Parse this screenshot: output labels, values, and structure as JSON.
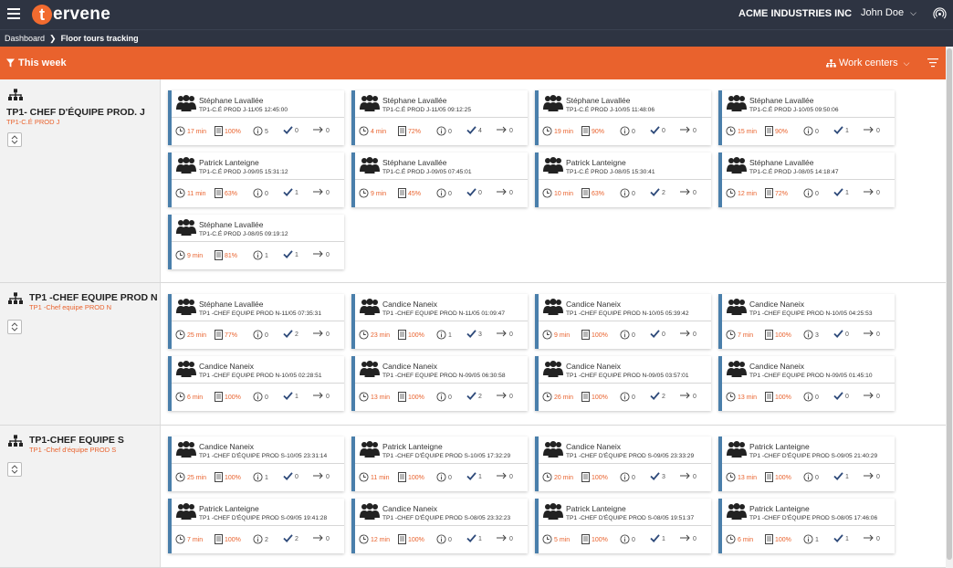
{
  "header": {
    "logo_letter": "t",
    "logo_text": "ervene",
    "company": "ACME INDUSTRIES INC",
    "user": "John Doe"
  },
  "breadcrumb": {
    "root": "Dashboard",
    "current": "Floor tours tracking"
  },
  "filterbar": {
    "period_label": "This week",
    "work_centers_label": "Work centers"
  },
  "colors": {
    "accent": "#e9622d",
    "topbar": "#2e3442",
    "card_border": "#4a7fab"
  },
  "groups": [
    {
      "title": "TP1- CHEF D'ÉQUIPE PROD. J",
      "subtitle": "TP1-C.É PROD J",
      "cards": [
        {
          "name": "Stéphane Lavallée",
          "sub": "TP1-C.É PROD J-11/05 12:45:00",
          "time": "17 min",
          "pct": "100%",
          "issues": "5",
          "checks": "0",
          "arrows": "0"
        },
        {
          "name": "Stéphane Lavallée",
          "sub": "TP1-C.É PROD J-11/05 09:12:25",
          "time": "4 min",
          "pct": "72%",
          "issues": "0",
          "checks": "4",
          "arrows": "0"
        },
        {
          "name": "Stéphane Lavallée",
          "sub": "TP1-C.É PROD J-10/05 11:48:06",
          "time": "19 min",
          "pct": "90%",
          "issues": "0",
          "checks": "0",
          "arrows": "0"
        },
        {
          "name": "Stéphane Lavallée",
          "sub": "TP1-C.É PROD J-10/05 09:50:06",
          "time": "15 min",
          "pct": "90%",
          "issues": "0",
          "checks": "1",
          "arrows": "0"
        },
        {
          "name": "Patrick Lanteigne",
          "sub": "TP1-C.É PROD J-09/05 15:31:12",
          "time": "11 min",
          "pct": "63%",
          "issues": "0",
          "checks": "1",
          "arrows": "0"
        },
        {
          "name": "Stéphane Lavallée",
          "sub": "TP1-C.É PROD J-09/05 07:45:01",
          "time": "9 min",
          "pct": "45%",
          "issues": "0",
          "checks": "0",
          "arrows": "0"
        },
        {
          "name": "Patrick Lanteigne",
          "sub": "TP1-C.É PROD J-08/05 15:30:41",
          "time": "10 min",
          "pct": "63%",
          "issues": "0",
          "checks": "2",
          "arrows": "0"
        },
        {
          "name": "Stéphane Lavallée",
          "sub": "TP1-C.É PROD J-08/05 14:18:47",
          "time": "12 min",
          "pct": "72%",
          "issues": "0",
          "checks": "1",
          "arrows": "0"
        },
        {
          "name": "Stéphane Lavallée",
          "sub": "TP1-C.É PROD J-08/05 09:19:12",
          "time": "9 min",
          "pct": "81%",
          "issues": "1",
          "checks": "1",
          "arrows": "0"
        }
      ]
    },
    {
      "title": "TP1 -CHEF EQUIPE PROD N",
      "subtitle": "TP1 -Chef equipe PROD N",
      "cards": [
        {
          "name": "Stéphane Lavallée",
          "sub": "TP1 -CHEF EQUIPE PROD N-11/05 07:35:31",
          "time": "25 min",
          "pct": "77%",
          "issues": "0",
          "checks": "2",
          "arrows": "0"
        },
        {
          "name": "Candice Naneix",
          "sub": "TP1 -CHEF EQUIPE PROD N-11/05 01:09:47",
          "time": "23 min",
          "pct": "100%",
          "issues": "1",
          "checks": "3",
          "arrows": "0"
        },
        {
          "name": "Candice Naneix",
          "sub": "TP1 -CHEF EQUIPE PROD N-10/05 05:39:42",
          "time": "9 min",
          "pct": "100%",
          "issues": "0",
          "checks": "0",
          "arrows": "0"
        },
        {
          "name": "Candice Naneix",
          "sub": "TP1 -CHEF EQUIPE PROD N-10/05 04:25:53",
          "time": "7 min",
          "pct": "100%",
          "issues": "3",
          "checks": "0",
          "arrows": "0"
        },
        {
          "name": "Candice Naneix",
          "sub": "TP1 -CHEF EQUIPE PROD N-10/05 02:28:51",
          "time": "6 min",
          "pct": "100%",
          "issues": "0",
          "checks": "1",
          "arrows": "0"
        },
        {
          "name": "Candice Naneix",
          "sub": "TP1 -CHEF EQUIPE PROD N-09/05 06:30:58",
          "time": "13 min",
          "pct": "100%",
          "issues": "0",
          "checks": "2",
          "arrows": "0"
        },
        {
          "name": "Candice Naneix",
          "sub": "TP1 -CHEF EQUIPE PROD N-09/05 03:57:01",
          "time": "26 min",
          "pct": "100%",
          "issues": "0",
          "checks": "2",
          "arrows": "0"
        },
        {
          "name": "Candice Naneix",
          "sub": "TP1 -CHEF EQUIPE PROD N-09/05 01:45:10",
          "time": "13 min",
          "pct": "100%",
          "issues": "0",
          "checks": "0",
          "arrows": "0"
        }
      ]
    },
    {
      "title": "TP1-CHEF EQUIPE S",
      "subtitle": "TP1 -Chef d'équipe PROD S",
      "cards": [
        {
          "name": "Candice Naneix",
          "sub": "TP1 -CHEF D'ÉQUIPE PROD S-10/05 23:31:14",
          "time": "25 min",
          "pct": "100%",
          "issues": "1",
          "checks": "0",
          "arrows": "0"
        },
        {
          "name": "Patrick Lanteigne",
          "sub": "TP1 -CHEF D'ÉQUIPE PROD S-10/05 17:32:29",
          "time": "11 min",
          "pct": "100%",
          "issues": "0",
          "checks": "1",
          "arrows": "0"
        },
        {
          "name": "Candice Naneix",
          "sub": "TP1 -CHEF D'ÉQUIPE PROD S-09/05 23:33:29",
          "time": "20 min",
          "pct": "100%",
          "issues": "0",
          "checks": "3",
          "arrows": "0"
        },
        {
          "name": "Patrick Lanteigne",
          "sub": "TP1 -CHEF D'ÉQUIPE PROD S-09/05 21:40:29",
          "time": "13 min",
          "pct": "100%",
          "issues": "0",
          "checks": "1",
          "arrows": "0"
        },
        {
          "name": "Patrick Lanteigne",
          "sub": "TP1 -CHEF D'ÉQUIPE PROD S-09/05 19:41:28",
          "time": "7 min",
          "pct": "100%",
          "issues": "2",
          "checks": "2",
          "arrows": "0"
        },
        {
          "name": "Candice Naneix",
          "sub": "TP1 -CHEF D'ÉQUIPE PROD S-08/05 23:32:23",
          "time": "12 min",
          "pct": "100%",
          "issues": "0",
          "checks": "1",
          "arrows": "0"
        },
        {
          "name": "Patrick Lanteigne",
          "sub": "TP1 -CHEF D'ÉQUIPE PROD S-08/05 19:51:37",
          "time": "5 min",
          "pct": "100%",
          "issues": "0",
          "checks": "1",
          "arrows": "0"
        },
        {
          "name": "Patrick Lanteigne",
          "sub": "TP1 -CHEF D'ÉQUIPE PROD S-08/05 17:46:06",
          "time": "6 min",
          "pct": "100%",
          "issues": "1",
          "checks": "1",
          "arrows": "0"
        }
      ]
    }
  ]
}
